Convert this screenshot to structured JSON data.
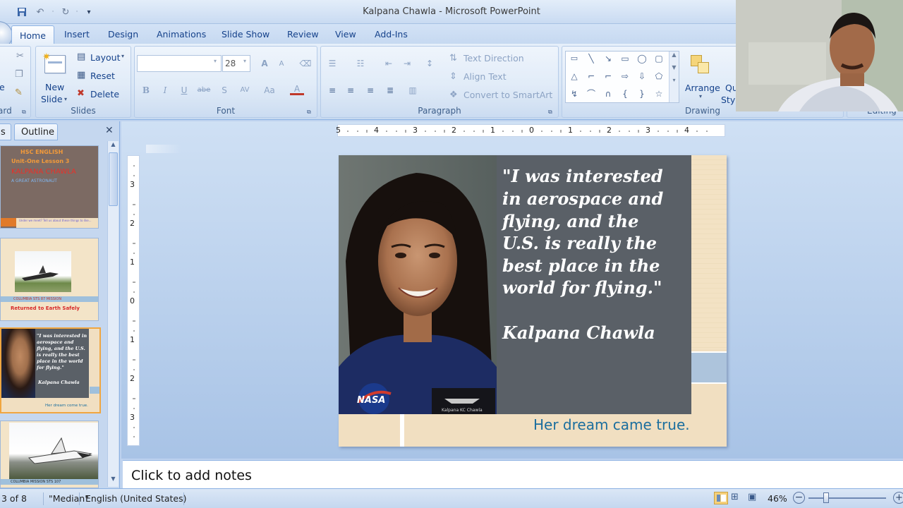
{
  "window": {
    "title": "Kalpana Chawla - Microsoft PowerPoint"
  },
  "tabs": [
    {
      "label": "Home"
    },
    {
      "label": "Insert"
    },
    {
      "label": "Design"
    },
    {
      "label": "Animations"
    },
    {
      "label": "Slide Show"
    },
    {
      "label": "Review"
    },
    {
      "label": "View"
    },
    {
      "label": "Add-Ins"
    }
  ],
  "ribbon": {
    "clipboard": {
      "label": "ard",
      "paste_partial": "e"
    },
    "slides": {
      "label": "Slides",
      "new_slide": "New",
      "new_slide_2": "Slide",
      "layout": "Layout",
      "reset": "Reset",
      "delete": "Delete"
    },
    "font": {
      "label": "Font",
      "size": "28",
      "bold": "B",
      "italic": "I",
      "underline": "U",
      "strike": "abe",
      "shadow": "S",
      "spacing": "AV",
      "case": "Aa",
      "color": "A",
      "grow": "A",
      "shrink": "A"
    },
    "paragraph": {
      "label": "Paragraph",
      "text_direction": "Text Direction",
      "align_text": "Align Text",
      "convert_smartart": "Convert to SmartArt"
    },
    "drawing": {
      "label": "Drawing",
      "arrange": "Arrange",
      "quick_partial": "Qu",
      "styles_partial": "Styl"
    },
    "editing": {
      "label": "Editing"
    }
  },
  "leftpane": {
    "tab_slides_partial": "s",
    "tab_outline": "Outline",
    "close": "✕",
    "thumbs": [
      {
        "line1": "HSC ENGLISH",
        "line2": "Unit-One Lesson 3",
        "line3": "KALPANA CHAWLA",
        "line4": "A GREAT ASTRONAUT",
        "footer": "Under we meet? Tell us about these things to like..."
      },
      {
        "caption1": "COLUMBIA STS 87 MISSION",
        "caption2": "Returned to Earth Safely"
      },
      {
        "quote": "\"I was interested in aerospace and flying, and the U.S. is really the best place in the world for flying.\"",
        "author": "Kalpana Chawla",
        "footer": "Her dream come true."
      },
      {
        "caption": "COLUMBIA MISSION STS 107"
      }
    ]
  },
  "slide": {
    "quote_lines": [
      "\"I was interested",
      "in aerospace and",
      "flying, and the",
      "U.S. is really the",
      "best place in the",
      "world for flying.\""
    ],
    "author": "Kalpana Chawla",
    "footer": "Her dream came true.",
    "nasa": "NASA",
    "badge": "Kalpana KC Chawla"
  },
  "ruler": {
    "h_ticks": [
      "5",
      "4",
      "3",
      "2",
      "1",
      "0",
      "1",
      "2",
      "3",
      "4"
    ],
    "v_ticks": [
      "3",
      "2",
      "1",
      "0",
      "1",
      "2",
      "3"
    ]
  },
  "notes": {
    "placeholder": "Click to add notes"
  },
  "status": {
    "slide": "3 of 8",
    "theme": "\"Median\"",
    "language": "English (United States)",
    "zoom": "46%"
  }
}
